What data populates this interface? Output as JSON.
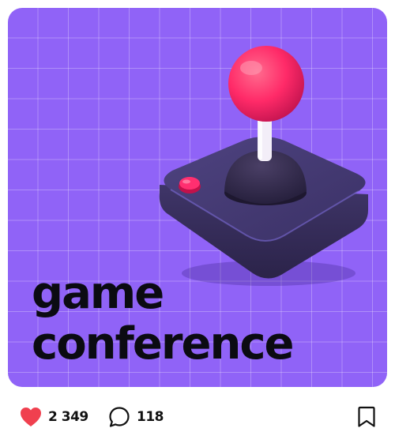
{
  "post": {
    "headline_line1": "game",
    "headline_line2": "conference",
    "background_color": "#9063f7",
    "illustration": "joystick-illustration"
  },
  "actions": {
    "likes_count": "2 349",
    "comments_count": "118",
    "like_icon": "heart-icon",
    "comment_icon": "speech-bubble-icon",
    "bookmark_icon": "bookmark-icon",
    "heart_color": "#f0404f"
  }
}
